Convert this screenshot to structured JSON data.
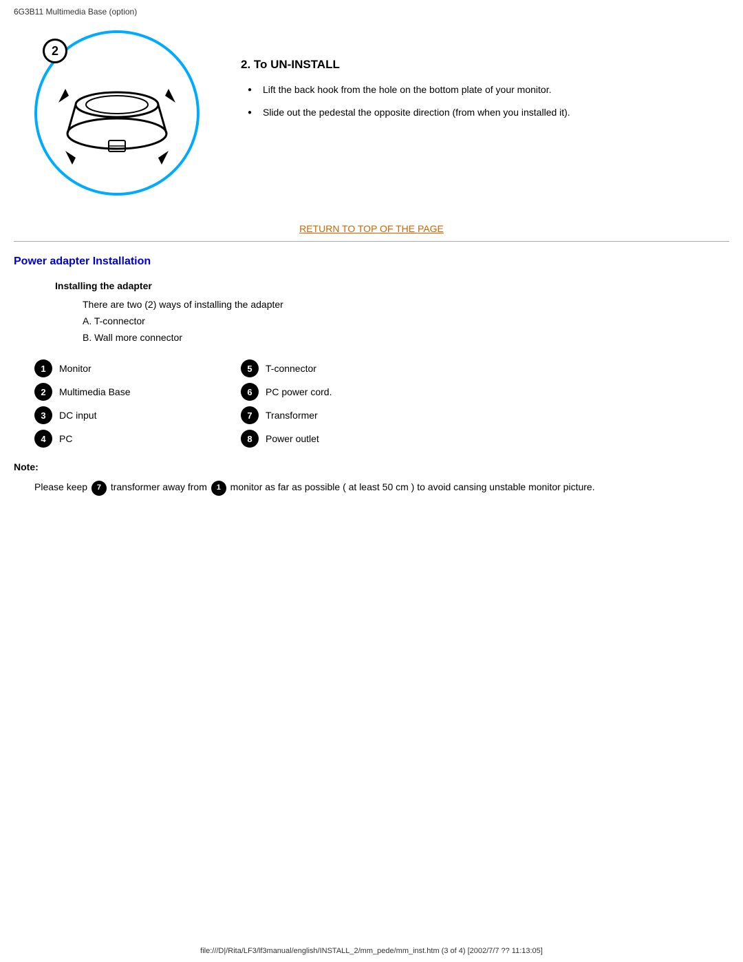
{
  "header": {
    "title": "6G3B11 Multimedia Base (option)"
  },
  "uninstall_section": {
    "step_number": "2",
    "title": "2. To UN-INSTALL",
    "bullets": [
      "Lift the back hook from the hole on the bottom plate of your monitor.",
      "Slide out the pedestal the opposite direction (from when you installed it)."
    ]
  },
  "return_link": {
    "label": "RETURN TO TOP OF THE PAGE"
  },
  "power_section": {
    "title": "Power adapter Installation",
    "adapter_subtitle": "Installing the adapter",
    "adapter_body_line1": "There are two (2) ways of installing the adapter",
    "adapter_body_line2": "A. T-connector",
    "adapter_body_line3": "B. Wall more connector",
    "items": [
      {
        "number": "1",
        "label": "Monitor"
      },
      {
        "number": "5",
        "label": "T-connector"
      },
      {
        "number": "2",
        "label": "Multimedia Base"
      },
      {
        "number": "6",
        "label": "PC power cord."
      },
      {
        "number": "3",
        "label": "DC input"
      },
      {
        "number": "7",
        "label": "Transformer"
      },
      {
        "number": "4",
        "label": "PC"
      },
      {
        "number": "8",
        "label": "Power outlet"
      }
    ],
    "note_label": "Note:",
    "note_text_prefix": "Please keep ",
    "note_badge_7": "7",
    "note_text_middle": " transformer away from ",
    "note_badge_1": "1",
    "note_text_suffix": " monitor as far as possible ( at least 50 cm ) to avoid cansing unstable monitor picture."
  },
  "footer": {
    "text": "file:///D|/Rita/LF3/lf3manual/english/INSTALL_2/mm_pede/mm_inst.htm (3 of 4) [2002/7/7 ?? 11:13:05]"
  }
}
